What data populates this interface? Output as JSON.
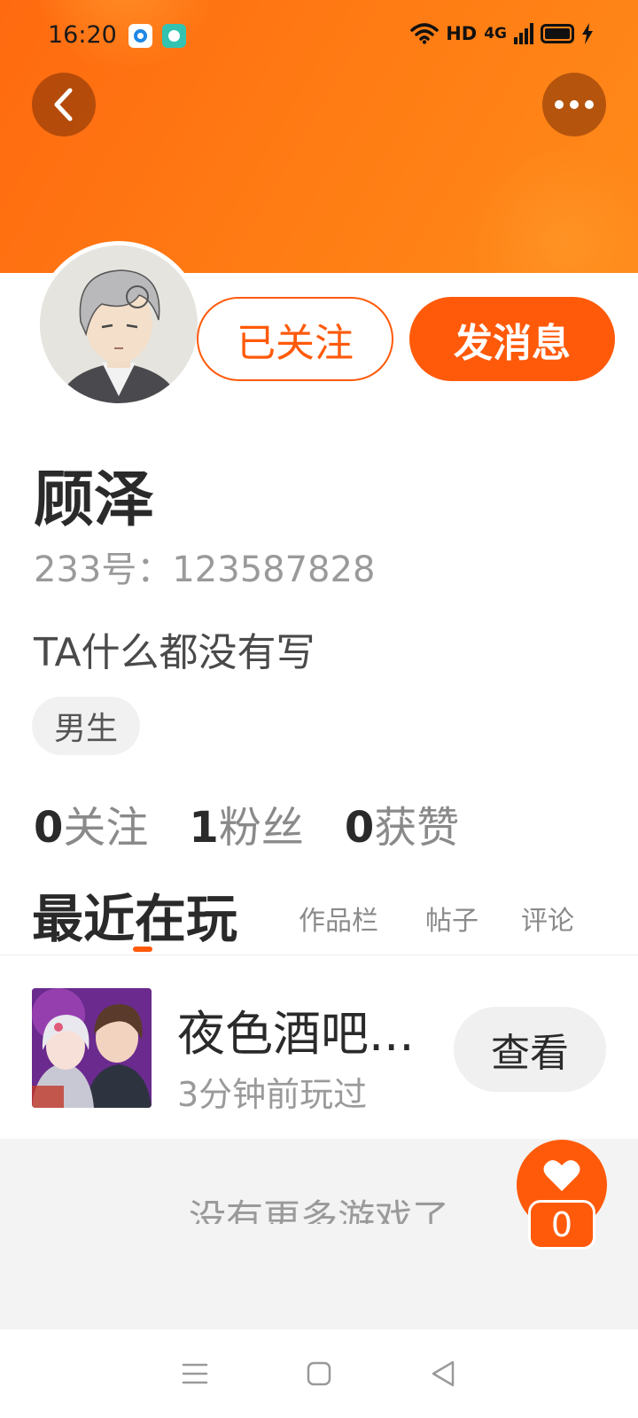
{
  "status_bar": {
    "time": "16:20",
    "network": "HD",
    "signal": "4G"
  },
  "header": {
    "back_icon": "chevron-left-icon",
    "more_icon": "more-dots-icon"
  },
  "profile": {
    "follow_button": "已关注",
    "message_button": "发消息",
    "name": "顾泽",
    "uid": "233号：123587828",
    "bio": "TA什么都没有写",
    "gender_tag": "男生",
    "stats": [
      {
        "num": "0",
        "label": "关注"
      },
      {
        "num": "1",
        "label": "粉丝"
      },
      {
        "num": "0",
        "label": "获赞"
      }
    ]
  },
  "tabs": {
    "active": "最近在玩",
    "items": [
      "作品栏",
      "帖子",
      "评论"
    ]
  },
  "recent_game": {
    "title": "夜色酒吧...",
    "played": "3分钟前玩过",
    "view_button": "查看"
  },
  "footer": {
    "no_more": "没有更多游戏了",
    "like_count": "0"
  },
  "colors": {
    "accent": "#ff5a0a",
    "header_gradient_start": "#ff6a10",
    "header_gradient_end": "#ff8a1a"
  }
}
